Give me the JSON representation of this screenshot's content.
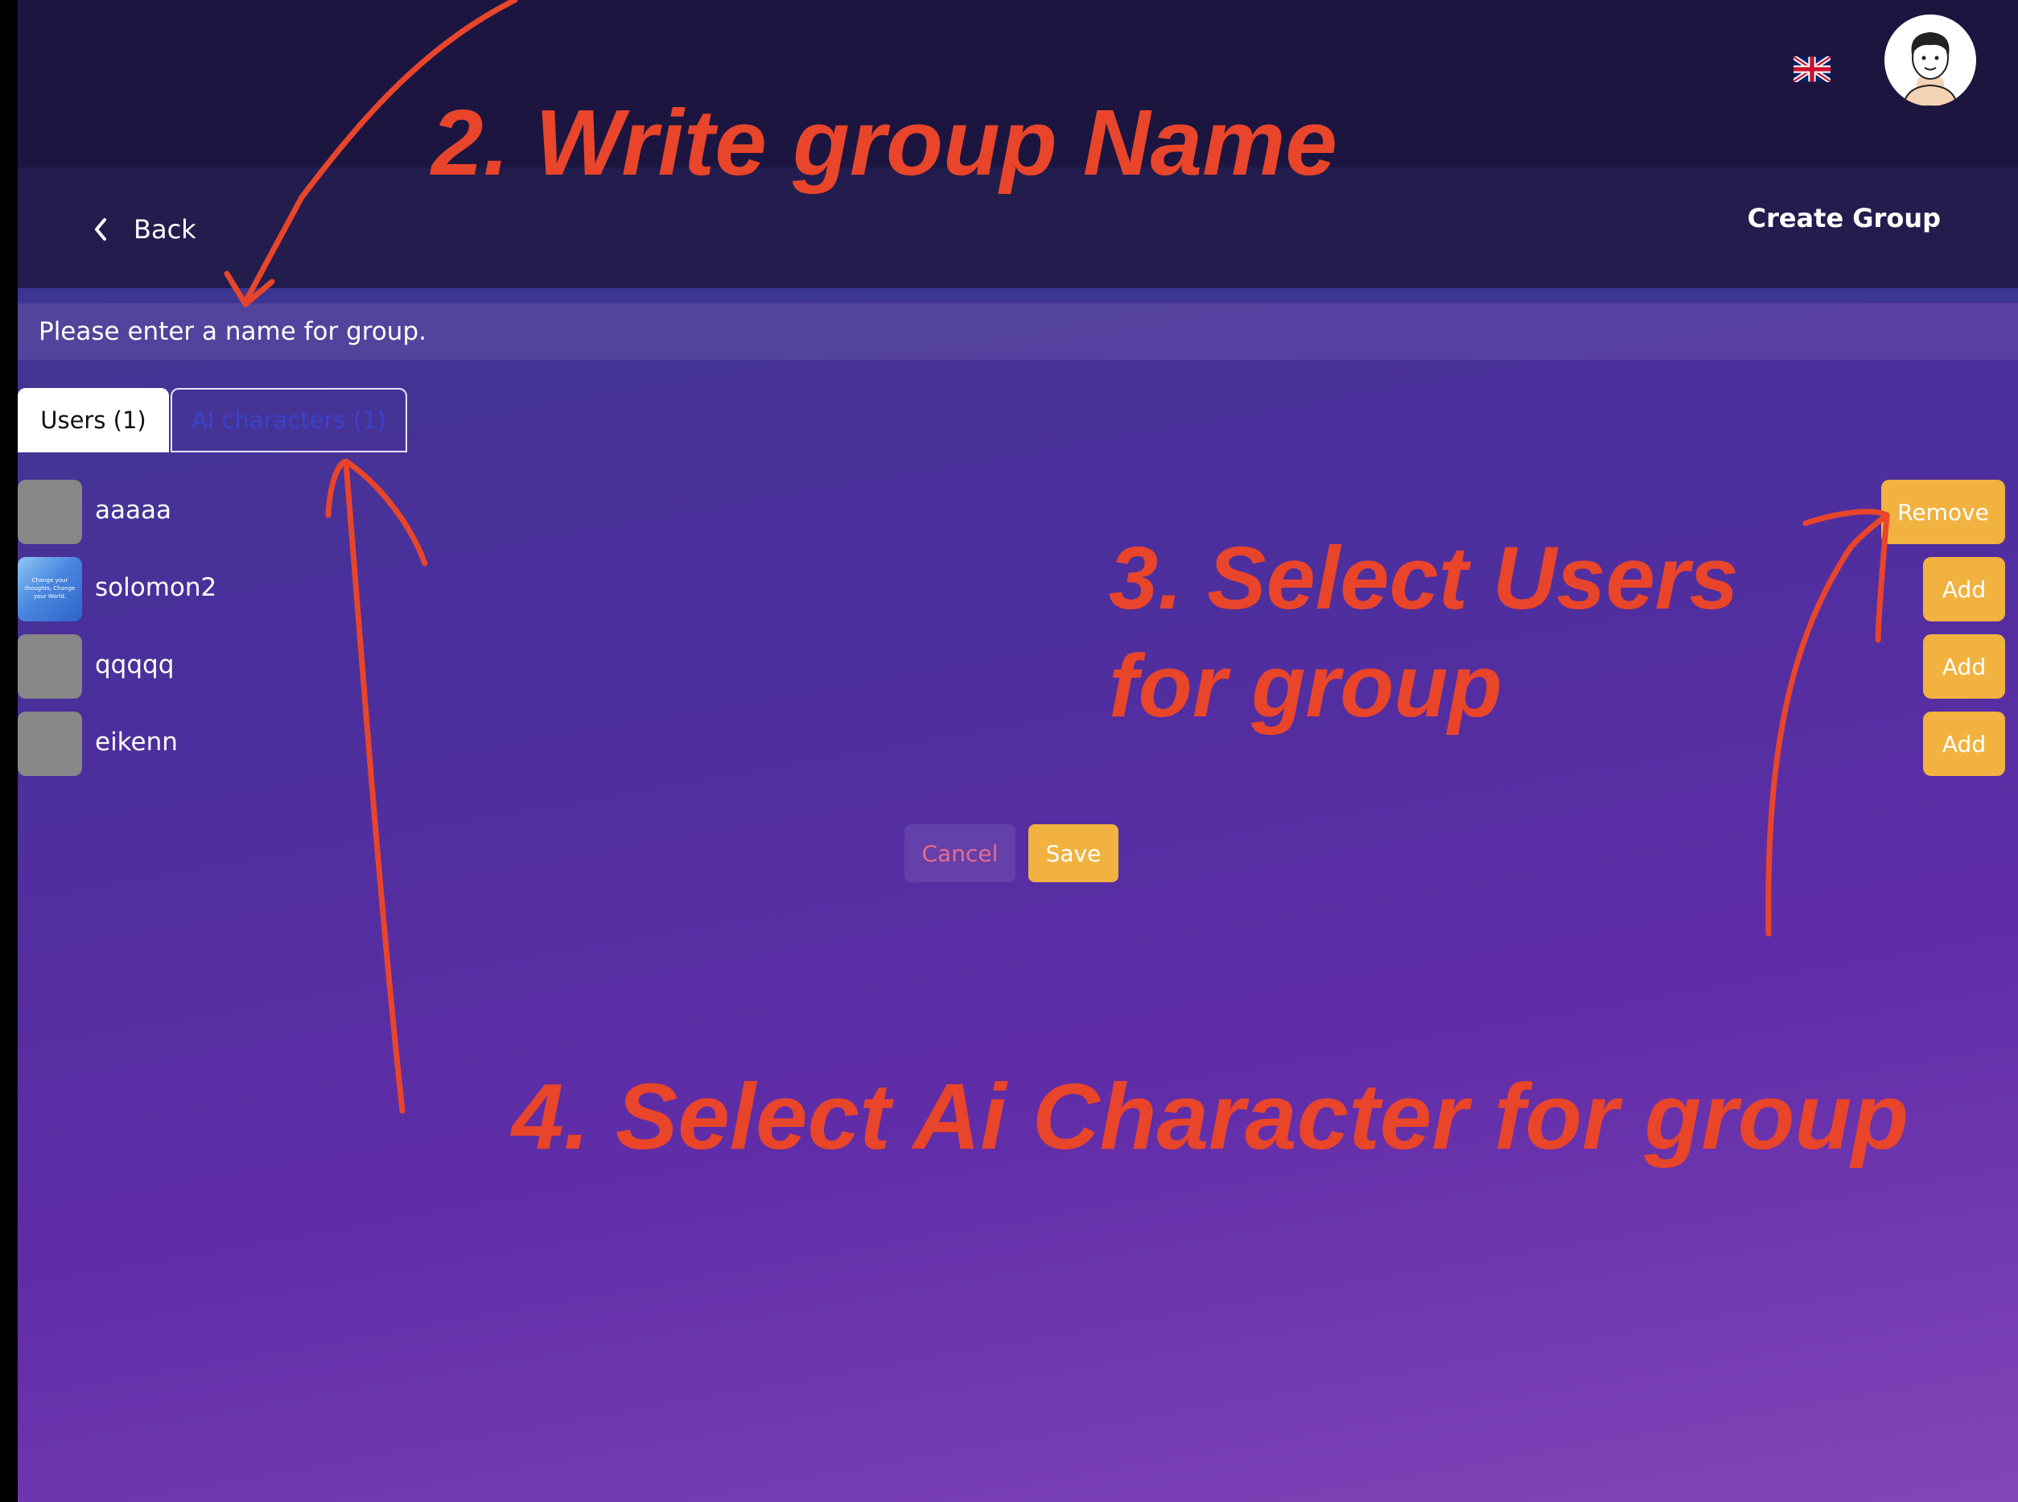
{
  "header": {
    "language_icon": "uk-flag-icon",
    "avatar_icon": "user-avatar-icon"
  },
  "nav": {
    "back_label": "Back",
    "back_icon": "chevron-left-icon",
    "title": "Create Group"
  },
  "group_name": {
    "value": "",
    "placeholder": "Please enter a name for group."
  },
  "tabs": [
    {
      "label": "Users (1)",
      "active": true
    },
    {
      "label": "AI characters (1)",
      "active": false
    }
  ],
  "users": [
    {
      "name": "aaaaa",
      "action": "Remove",
      "thumb_text": ""
    },
    {
      "name": "solomon2",
      "action": "Add",
      "thumb_text": "Change your thoughts, Change your World."
    },
    {
      "name": "qqqqq",
      "action": "Add",
      "thumb_text": ""
    },
    {
      "name": "eikenn",
      "action": "Add",
      "thumb_text": ""
    }
  ],
  "footer": {
    "cancel_label": "Cancel",
    "save_label": "Save"
  },
  "annotations": {
    "step2": "2. Write group Name",
    "step3_line1": "3. Select Users",
    "step3_line2": "for group",
    "step4": "4. Select Ai Character for group"
  },
  "colors": {
    "accent": "#f1b23f",
    "annotation": "#e8452b",
    "header_bg": "#1c1540",
    "cancel_text": "#e86c8d"
  }
}
